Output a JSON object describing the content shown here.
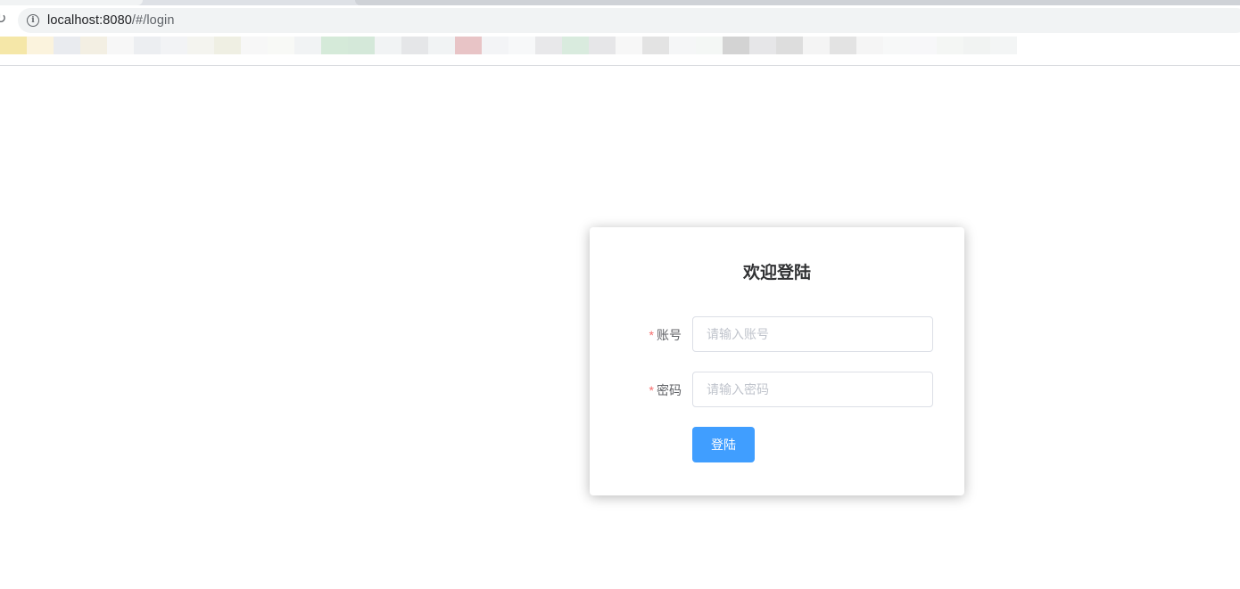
{
  "browser": {
    "url_host": "localhost:8080",
    "url_path": "/#/login",
    "reload_icon": "reload-icon",
    "info_icon": "info-icon"
  },
  "bookmarks": {
    "colors": [
      "#f5e7a8",
      "#fbf3dd",
      "#e9ebef",
      "#f3efe3",
      "#f7f7f7",
      "#eceef1",
      "#f2f3f5",
      "#f4f4ef",
      "#efefe3",
      "#f7f7f7",
      "#f8f9f6",
      "#f1f3f4",
      "#d5ead9",
      "#d4e8d9",
      "#f1f3f4",
      "#e5e6e8",
      "#f1f3f4",
      "#e8c4c6",
      "#f3f4f6",
      "#f7f8f9",
      "#e8e8ea",
      "#d9ebde",
      "#e6e6e8",
      "#f7f7f7",
      "#e3e3e3",
      "#f5f6f7",
      "#f4f7f5",
      "#d3d3d3",
      "#e6e6e8",
      "#dddddd",
      "#f4f4f4",
      "#e3e3e3",
      "#f5f5f5",
      "#f7f8f8",
      "#f7f7f9",
      "#f4f6f4",
      "#f1f3f2",
      "#f3f5f5"
    ]
  },
  "login": {
    "title": "欢迎登陆",
    "account": {
      "required_mark": "*",
      "label": "账号",
      "value": "",
      "placeholder": "请输入账号"
    },
    "password": {
      "required_mark": "*",
      "label": "密码",
      "value": "",
      "placeholder": "请输入密码"
    },
    "submit_label": "登陆",
    "accent_color": "#409eff",
    "required_color": "#f56c6c"
  }
}
